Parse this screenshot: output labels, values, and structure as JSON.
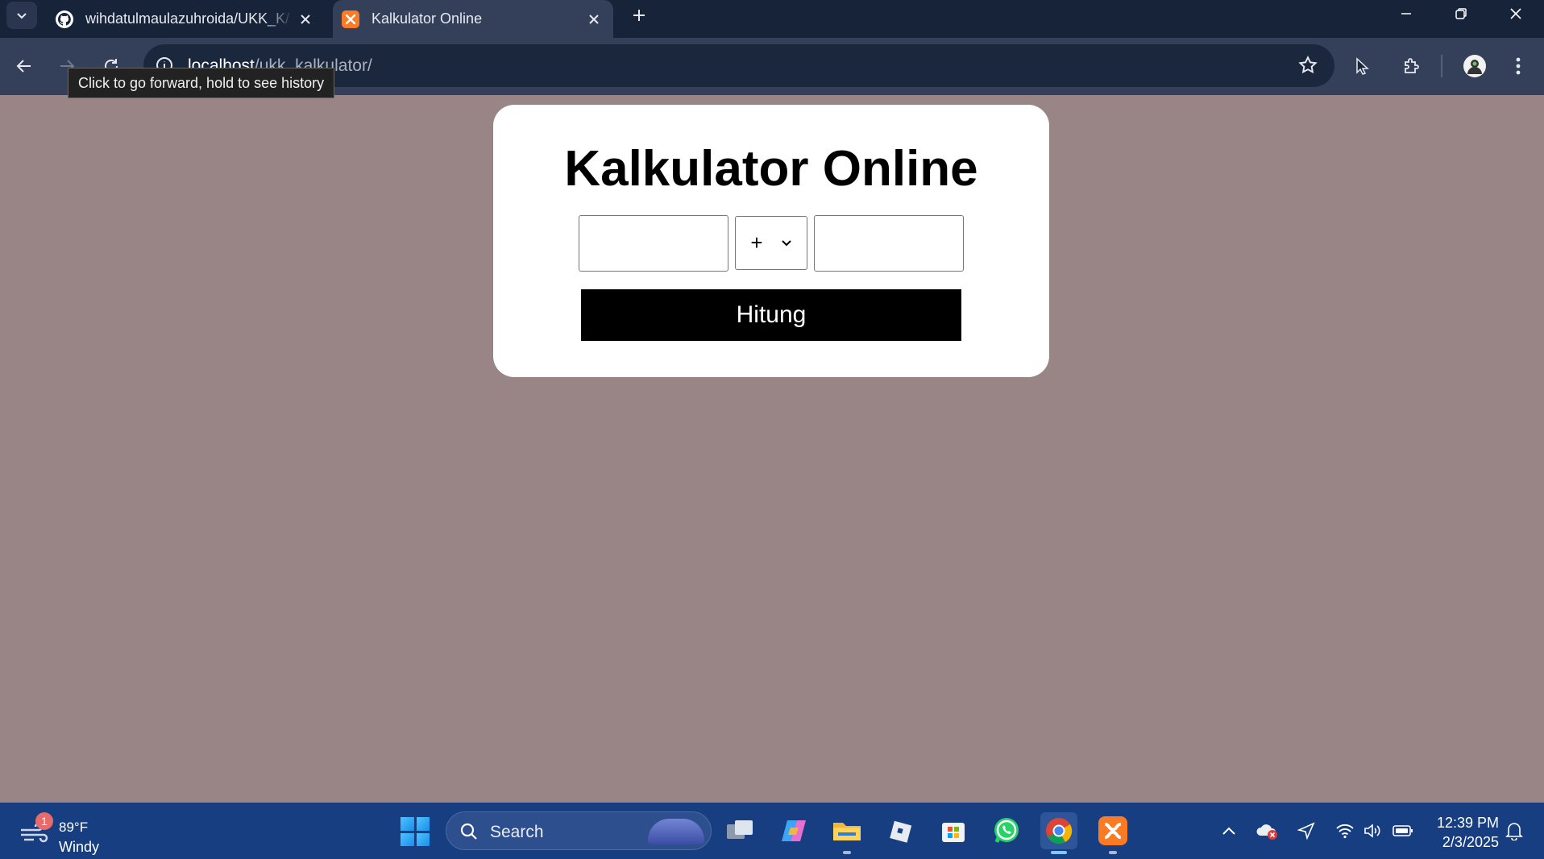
{
  "browser": {
    "tabs": [
      {
        "title": "wihdatulmaulazuhroida/UKK_K/",
        "active": false
      },
      {
        "title": "Kalkulator Online",
        "active": true
      }
    ],
    "url_host": "localhost",
    "url_path": "/ukk_kalkulator/",
    "tooltip": "Click to go forward, hold to see history"
  },
  "page": {
    "heading": "Kalkulator Online",
    "first_number": "",
    "operator_options": [
      "+"
    ],
    "operator_selected": "+",
    "second_number": "",
    "submit_label": "Hitung",
    "background_color": "#998585"
  },
  "taskbar": {
    "weather_temp": "89°F",
    "weather_desc": "Windy",
    "weather_badge": "1",
    "search_label": "Search",
    "time": "12:39 PM",
    "date": "2/3/2025",
    "apps": [
      "task-view",
      "copilot",
      "file-explorer",
      "roblox",
      "microsoft-store",
      "whatsapp",
      "chrome",
      "xampp"
    ]
  }
}
